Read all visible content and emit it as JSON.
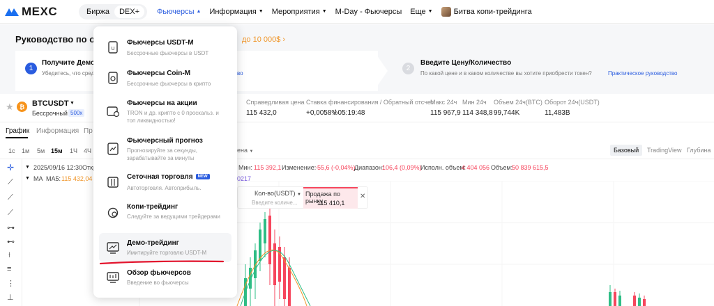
{
  "brand": {
    "name": "MEXC"
  },
  "topnav": {
    "exchange_tab": "Биржа",
    "dex_tab": "DEX+",
    "items": [
      "Фьючерсы",
      "Информация",
      "Мероприятия",
      "M-Day - Фьючерсы",
      "Еще",
      "Битва копи-трейдинга"
    ]
  },
  "banner": {
    "title": "Руководство по орд",
    "promo": "до 10 000$ ›",
    "step1": {
      "num": "1",
      "title": "Получите Демо",
      "desc": "Убедитесь, что сред",
      "link": "во"
    },
    "step2": {
      "num": "2",
      "title": "Введите Цену/Количество",
      "desc": "По какой цене и в каком количестве вы хотите приобрести токен?",
      "link": "Практическое руководство"
    }
  },
  "ticker": {
    "symbol": "BTCUSDT",
    "type": "Бессрочный",
    "leverage": "500x",
    "fair_price_label": "Справедливая цена",
    "fair_price": "115 432,0",
    "funding_label": "Ставка финансирования / Обратный отсчет",
    "funding": "+0,0058%",
    "countdown": "/ 05:19:48",
    "high_label": "Макс 24ч",
    "high": "115 967,9",
    "low_label": "Мин 24ч",
    "low": "114 348,8",
    "vol_btc_label": "Объем 24ч(BTC)",
    "vol_btc": "99,744K",
    "turnover_label": "Оборот 24ч(USDT)",
    "turnover": "11,483B"
  },
  "tabs": {
    "chart": "График",
    "info": "Информация",
    "more": "Пр"
  },
  "intervals": [
    "1с",
    "1м",
    "5м",
    "15м",
    "1Ч",
    "4Ч"
  ],
  "chart_views": [
    "Базовый",
    "TradingView",
    "Глубина"
  ],
  "ohlc": {
    "date": "2025/09/16 12:30",
    "open_label": "Откр",
    "min_label": "Мин:",
    "min": "115 392,1",
    "change_label": "Изменение:",
    "change": "-55,6 (-0,04%)",
    "range_label": "Диапазон:",
    "range": "106,4 (0,09%)",
    "exec_label": "Исполн. объем:",
    "exec": "4 404 056",
    "vol_label": "Объем:",
    "vol": "50 839 615,5"
  },
  "ma": {
    "label": "MA",
    "ma5_label": "MA5:",
    "ma5": "115 432,04",
    "ma_extra": "0217"
  },
  "price_mark": "ена",
  "order_popup": {
    "qty_label": "Кол-во(USDT)",
    "qty_placeholder": "Введите количе...",
    "sell_label": "Продажа по рынку",
    "sell_price": "115 410,1"
  },
  "dropdown": {
    "items": [
      {
        "title": "Фьючерсы USDT-M",
        "desc": "Бессрочные фьючерсы в USDT",
        "icon": "usdt-futures-icon"
      },
      {
        "title": "Фьючерсы Coin-M",
        "desc": "Бессрочные фьючерсы в крипто",
        "icon": "coin-futures-icon"
      },
      {
        "title": "Фьючерсы на акции",
        "desc": "TRON и др. крипто с 0 проскальз. и топ ликвидностью!",
        "icon": "stock-futures-icon"
      },
      {
        "title": "Фьючерсный прогноз",
        "desc": "Прогнозируйте за секунды, зарабатывайте за минуты",
        "icon": "forecast-icon"
      },
      {
        "title": "Сеточная торговля",
        "desc": "Автоторговля. Автоприбыль.",
        "badge": "NEW",
        "icon": "grid-trading-icon"
      },
      {
        "title": "Копи-трейдинг",
        "desc": "Следуйте за ведущими трейдерами",
        "icon": "copy-trading-icon"
      },
      {
        "title": "Демо-трейдинг",
        "desc": "Имитируйте торговлю USDT-M",
        "icon": "demo-trading-icon"
      },
      {
        "title": "Обзор фьючерсов",
        "desc": "Введение во фьючерсы",
        "icon": "futures-overview-icon"
      }
    ]
  },
  "colors": {
    "accent": "#2a5cdf",
    "up": "#2ebd85",
    "down": "#f6465d",
    "promo": "#f0962a",
    "annotation": "#e3142d"
  }
}
